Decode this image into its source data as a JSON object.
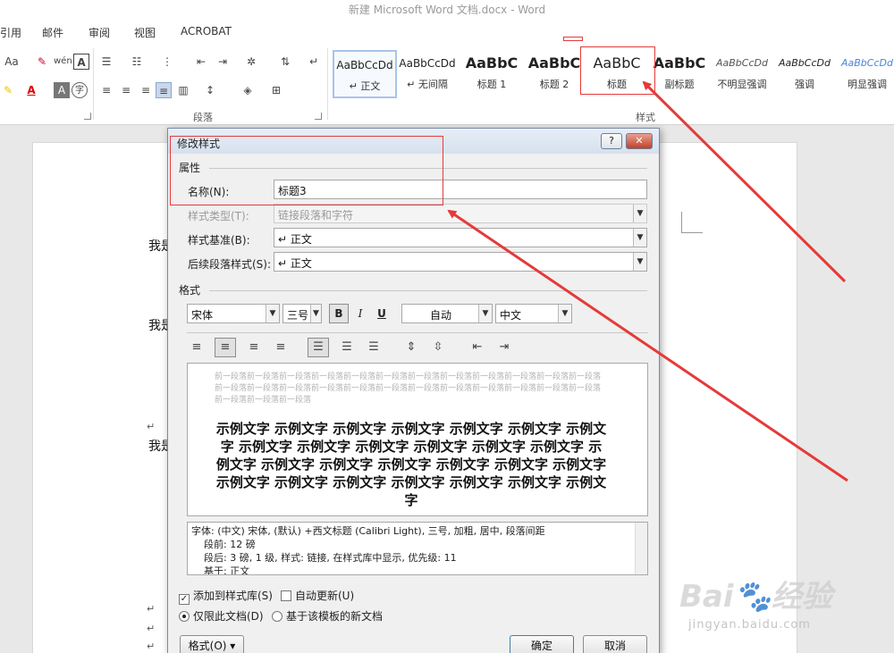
{
  "window": {
    "title": "新建 Microsoft Word 文档.docx - Word"
  },
  "menu": [
    "引用",
    "邮件",
    "审阅",
    "视图",
    "ACROBAT"
  ],
  "ribbon": {
    "paragraph_group": "段落",
    "styles_group": "样式",
    "font_size_partial": "Aa",
    "styles": [
      {
        "preview": "AaBbCcDd",
        "name": "↵ 正文",
        "selected": true
      },
      {
        "preview": "AaBbCcDd",
        "name": "↵ 无间隔"
      },
      {
        "preview": "AaBbC",
        "name": "标题 1"
      },
      {
        "preview": "AaBbC",
        "name": "标题 2"
      },
      {
        "preview": "AaBbC",
        "name": "标题"
      },
      {
        "preview": "AaBbC",
        "name": "副标题"
      },
      {
        "preview": "AaBbCcDd",
        "name": "不明显强调"
      },
      {
        "preview": "AaBbCcDd",
        "name": "强调"
      },
      {
        "preview": "AaBbCcDd",
        "name": "明显强调"
      }
    ]
  },
  "document": {
    "lines": [
      "我是",
      "我是",
      "我是"
    ],
    "para_mark": "↵"
  },
  "dialog": {
    "title": "修改样式",
    "help_label": "?",
    "close_label": "✕",
    "properties_label": "属性",
    "name_label": "名称(N):",
    "name_value": "标题3",
    "style_type_label": "样式类型(T):",
    "style_type_value": "链接段落和字符",
    "based_on_label": "样式基准(B):",
    "based_on_value": "↵ 正文",
    "following_label": "后续段落样式(S):",
    "following_value": "↵ 正文",
    "format_label": "格式",
    "font": "宋体",
    "size": "三号",
    "bold": "B",
    "italic": "I",
    "underline": "U",
    "color": "自动",
    "language": "中文",
    "preview_prev": "前一段落前一段落前一段落前一段落前一段落前一段落前一段落前一段落前一段落前一段落前一段落前一段落前一段落前一段落前一段落前一段落前一段落前一段落前一段落前一段落前一段落前一段落前一段落前一段落",
    "preview_prev_end": "前一段落前一段落前一段落",
    "preview_sample": "示例文字 示例文字 示例文字 示例文字 示例文字 示例文字 示例文字 示例文字 示例文字 示例文字 示例文字 示例文字 示例文字 示例文字 示例文字 示例文字 示例文字 示例文字 示例文字 示例文字 示例文字 示例文字 示例文字 示例文字 示例文字 示例文字 示例文字",
    "description": [
      "字体: (中文) 宋体, (默认) +西文标题 (Calibri Light), 三号, 加粗, 居中, 段落间距",
      "段前: 12 磅",
      "段后: 3 磅, 1 级, 样式: 链接, 在样式库中显示, 优先级: 11",
      "基于: 正文"
    ],
    "add_to_gallery": "添加到样式库(S)",
    "auto_update": "自动更新(U)",
    "only_this_doc": "仅限此文档(D)",
    "new_docs_template": "基于该模板的新文档",
    "format_button": "格式(O) ▾",
    "ok": "确定",
    "cancel": "取消"
  },
  "watermark": {
    "text": "jingyan.baidu.com"
  },
  "colors": {
    "annotation_red": "#e53a3a",
    "selected_style": "#a9c4e8"
  }
}
